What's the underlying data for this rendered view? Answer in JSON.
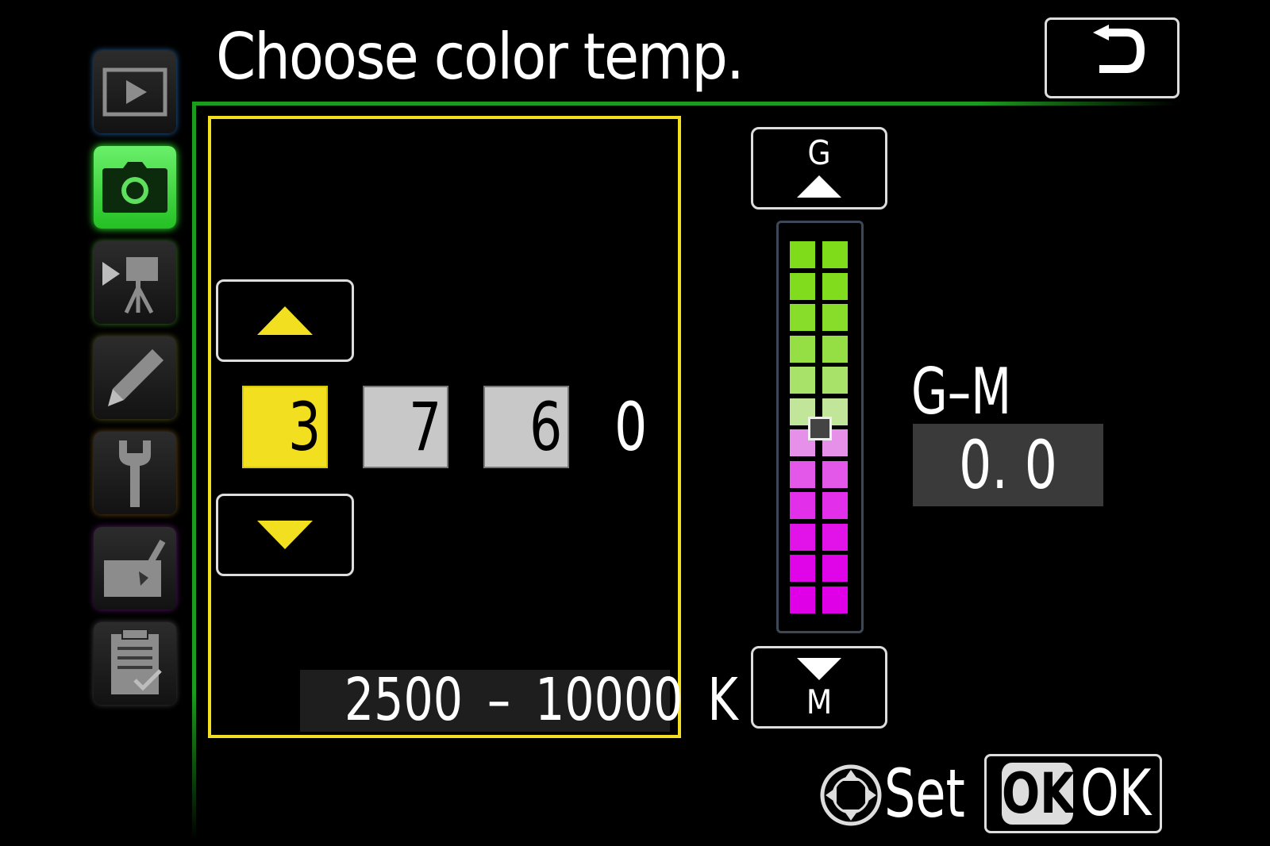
{
  "header": {
    "title": "Choose color temp.",
    "back_icon": "back-arrow-icon"
  },
  "menu_tabs": [
    {
      "name": "playback-menu-tab",
      "icon": "playback-icon",
      "active": false
    },
    {
      "name": "photo-shooting-menu-tab",
      "icon": "camera-icon",
      "active": true
    },
    {
      "name": "movie-shooting-menu-tab",
      "icon": "movie-camera-icon",
      "active": false
    },
    {
      "name": "custom-settings-menu-tab",
      "icon": "pencil-icon",
      "active": false
    },
    {
      "name": "setup-menu-tab",
      "icon": "wrench-icon",
      "active": false
    },
    {
      "name": "retouch-menu-tab",
      "icon": "retouch-brush-icon",
      "active": false
    },
    {
      "name": "my-menu-tab",
      "icon": "checklist-icon",
      "active": false
    }
  ],
  "color_temp": {
    "digits": [
      "3",
      "7",
      "6",
      "0"
    ],
    "selected_digit_index": 0,
    "up_icon": "triangle-up-icon",
    "down_icon": "triangle-down-icon",
    "range_label": "2500 – 10000 K"
  },
  "gm_bar": {
    "top_label": "G",
    "bottom_label": "M",
    "label": "G–M",
    "value": "0. 0",
    "position": 0.5
  },
  "footer": {
    "set_label": "Set",
    "ok_chip": "OK",
    "ok_label": "OK",
    "multi_selector_icon": "multi-selector-icon"
  },
  "colors": {
    "accent_yellow": "#f2e020",
    "menu_green": "#24c024",
    "frame_green": "#1c9c1c",
    "digit_grey": "#c8c8c8",
    "green_end": "#7fdc1a",
    "magenta_end": "#e000e8"
  }
}
